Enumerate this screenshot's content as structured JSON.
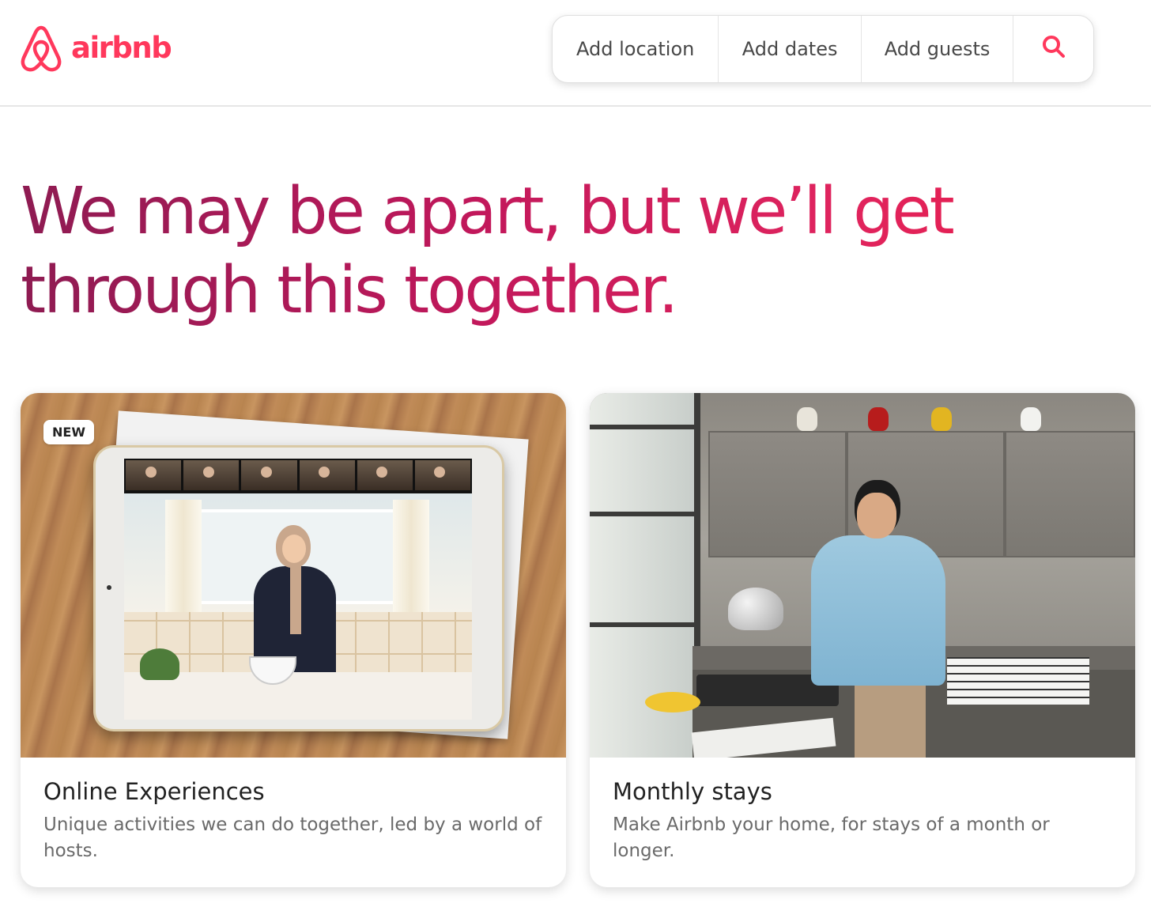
{
  "brand": {
    "name": "airbnb",
    "logo_icon": "airbnb-belo-icon",
    "color": "#ff385c"
  },
  "search": {
    "location_label": "Add location",
    "dates_label": "Add dates",
    "guests_label": "Add guests",
    "search_icon": "search-icon"
  },
  "hero": {
    "line1": "We may be apart, but we’ll get",
    "line2": "through this together.",
    "gradient_colors": [
      "#8e1b52",
      "#c2185b",
      "#e61e4d"
    ]
  },
  "cards": [
    {
      "badge": "NEW",
      "title": "Online Experiences",
      "description": "Unique activities we can do together, led by a world of hosts."
    },
    {
      "title": "Monthly stays",
      "description": "Make Airbnb your home, for stays of a month or longer."
    }
  ]
}
